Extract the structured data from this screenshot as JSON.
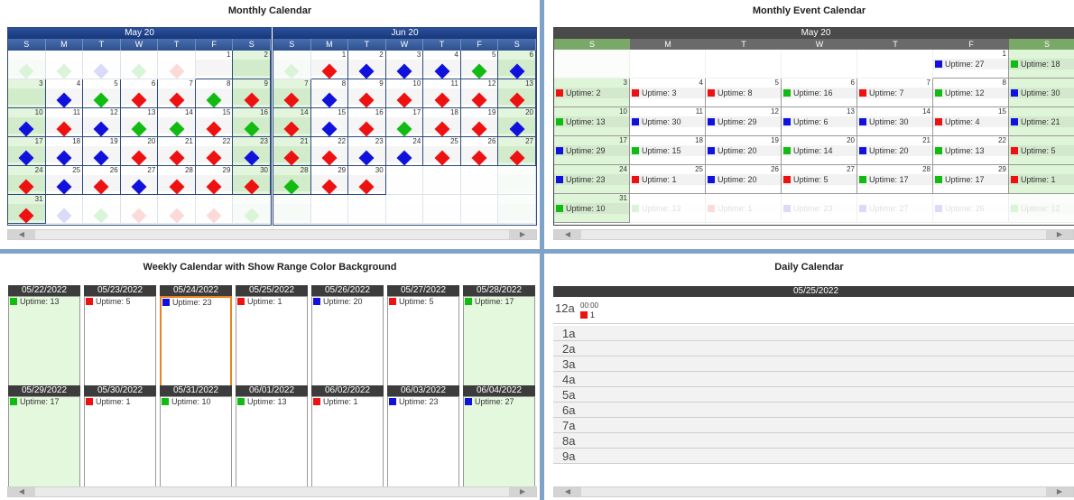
{
  "colors": {
    "red": "#ee1111",
    "green": "#11bb11",
    "blue": "#1111dd"
  },
  "monthly": {
    "title": "Monthly Calendar",
    "months": [
      {
        "label": "May 20",
        "offset": 0,
        "days": 31,
        "cells": [
          [
            "",
            "g",
            "",
            "",
            "",
            "",
            "",
            "",
            "b",
            "g",
            "r",
            "r",
            "g",
            "r",
            "b",
            "r",
            "b",
            "g",
            "g",
            "r",
            "g",
            "b",
            "b",
            "b",
            "r",
            "r",
            "r",
            "b",
            "r",
            "b",
            "r",
            "b",
            "r",
            "r",
            "r",
            "r",
            "b",
            "g",
            "r",
            "r",
            "r",
            "g",
            "g",
            "r",
            "r",
            "r",
            "b",
            "g",
            "b",
            "r",
            "g",
            "r",
            "r",
            "r",
            "b",
            "r",
            "r",
            "b",
            "g",
            "g",
            "g",
            "r"
          ]
        ]
      },
      {
        "label": "Jun 20"
      }
    ],
    "dow": [
      "S",
      "M",
      "T",
      "W",
      "T",
      "F",
      "S"
    ]
  },
  "event": {
    "title": "Monthly Event Calendar",
    "month": "May 20"
  },
  "weekly": {
    "title": "Weekly Calendar with Show Range Color Background",
    "weeks": [
      [
        {
          "d": "05/22/2022",
          "c": "green",
          "t": "Uptime: 13"
        },
        {
          "d": "05/23/2022",
          "c": "red",
          "t": "Uptime: 5"
        },
        {
          "d": "05/24/2022",
          "c": "blue",
          "t": "Uptime: 23"
        },
        {
          "d": "05/25/2022",
          "c": "red",
          "t": "Uptime: 1"
        },
        {
          "d": "05/26/2022",
          "c": "blue",
          "t": "Uptime: 20"
        },
        {
          "d": "05/27/2022",
          "c": "red",
          "t": "Uptime: 5"
        },
        {
          "d": "05/28/2022",
          "c": "green",
          "t": "Uptime: 17"
        }
      ],
      [
        {
          "d": "05/29/2022",
          "c": "green",
          "t": "Uptime: 17"
        },
        {
          "d": "05/30/2022",
          "c": "red",
          "t": "Uptime: 1"
        },
        {
          "d": "05/31/2022",
          "c": "green",
          "t": "Uptime: 10"
        },
        {
          "d": "06/01/2022",
          "c": "green",
          "t": "Uptime: 13"
        },
        {
          "d": "06/02/2022",
          "c": "red",
          "t": "Uptime: 1"
        },
        {
          "d": "06/03/2022",
          "c": "blue",
          "t": "Uptime: 23"
        },
        {
          "d": "06/04/2022",
          "c": "blue",
          "t": "Uptime: 27"
        }
      ]
    ]
  },
  "daily": {
    "title": "Daily Calendar",
    "date": "05/25/2022",
    "event_time": "00:00",
    "event_value": "1",
    "hours": [
      "12a",
      "1a",
      "2a",
      "3a",
      "4a",
      "5a",
      "6a",
      "7a",
      "8a",
      "9a"
    ]
  },
  "may_events": [
    [
      "blue",
      "Uptime: 27"
    ],
    [
      "green",
      "Uptime: 18"
    ],
    [
      "red",
      "Uptime: 2"
    ],
    [
      "red",
      "Uptime: 3"
    ],
    [
      "red",
      "Uptime: 8"
    ],
    [
      "green",
      "Uptime: 16"
    ],
    [
      "red",
      "Uptime: 7"
    ],
    [
      "green",
      "Uptime: 12"
    ],
    [
      "blue",
      "Uptime: 30"
    ],
    [
      "green",
      "Uptime: 13"
    ],
    [
      "blue",
      "Uptime: 30"
    ],
    [
      "blue",
      "Uptime: 29"
    ],
    [
      "blue",
      "Uptime: 6"
    ],
    [
      "blue",
      "Uptime: 30"
    ],
    [
      "red",
      "Uptime: 4"
    ],
    [
      "blue",
      "Uptime: 21"
    ],
    [
      "blue",
      "Uptime: 29"
    ],
    [
      "green",
      "Uptime: 15"
    ],
    [
      "blue",
      "Uptime: 20"
    ],
    [
      "green",
      "Uptime: 14"
    ],
    [
      "blue",
      "Uptime: 20"
    ],
    [
      "green",
      "Uptime: 13"
    ],
    [
      "red",
      "Uptime: 5"
    ],
    [
      "blue",
      "Uptime: 23"
    ],
    [
      "red",
      "Uptime: 1"
    ],
    [
      "blue",
      "Uptime: 20"
    ],
    [
      "red",
      "Uptime: 5"
    ],
    [
      "green",
      "Uptime: 17"
    ],
    [
      "green",
      "Uptime: 17"
    ],
    [
      "red",
      "Uptime: 1"
    ],
    [
      "green",
      "Uptime: 10"
    ]
  ],
  "jun_diamonds": [
    "g",
    "r",
    "b",
    "b",
    "b",
    "g",
    "b",
    "r",
    "b",
    "r",
    "r",
    "r",
    "r",
    "r",
    "r",
    "b",
    "r",
    "g",
    "r",
    "r",
    "b",
    "r",
    "r",
    "b",
    "b",
    "r",
    "r",
    "r",
    "g",
    "r",
    "r"
  ],
  "trail_events": [
    [
      "green",
      "Uptime: 13"
    ],
    [
      "red",
      "Uptime: 1"
    ],
    [
      "blue",
      "Uptime: 23"
    ],
    [
      "blue",
      "Uptime: 27"
    ],
    [
      "blue",
      "Uptime: 26"
    ],
    [
      "green",
      "Uptime: 12"
    ]
  ]
}
